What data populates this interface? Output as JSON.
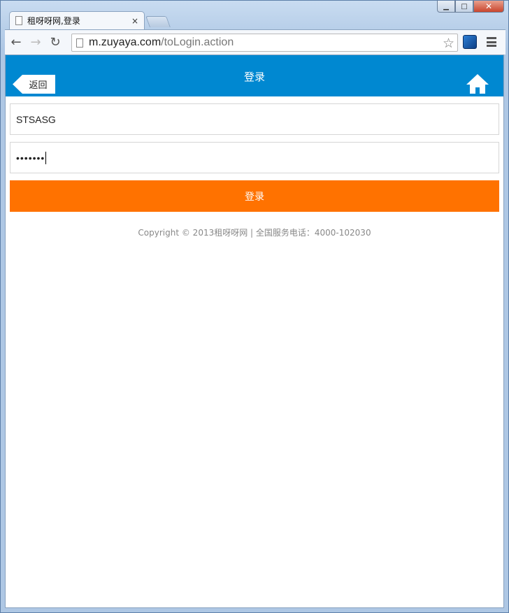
{
  "browser": {
    "tab_title": "租呀呀网,登录",
    "tab_close": "×",
    "url_host": "m.zuyaya.com",
    "url_path": "/toLogin.action",
    "window_controls": {
      "minimize": "▁",
      "maximize": "□",
      "close": "✕"
    },
    "nav": {
      "back": "←",
      "forward": "→",
      "reload": "↻",
      "star": "☆"
    }
  },
  "page": {
    "header_title": "登录",
    "back_label": "返回",
    "username_value": "STSASG",
    "password_value": "•••••••",
    "login_button": "登录",
    "copyright": "Copyright © 2013租呀呀网 | 全国服务电话：4000-102030"
  },
  "colors": {
    "header": "#0088d1",
    "login_button": "#ff7200"
  }
}
